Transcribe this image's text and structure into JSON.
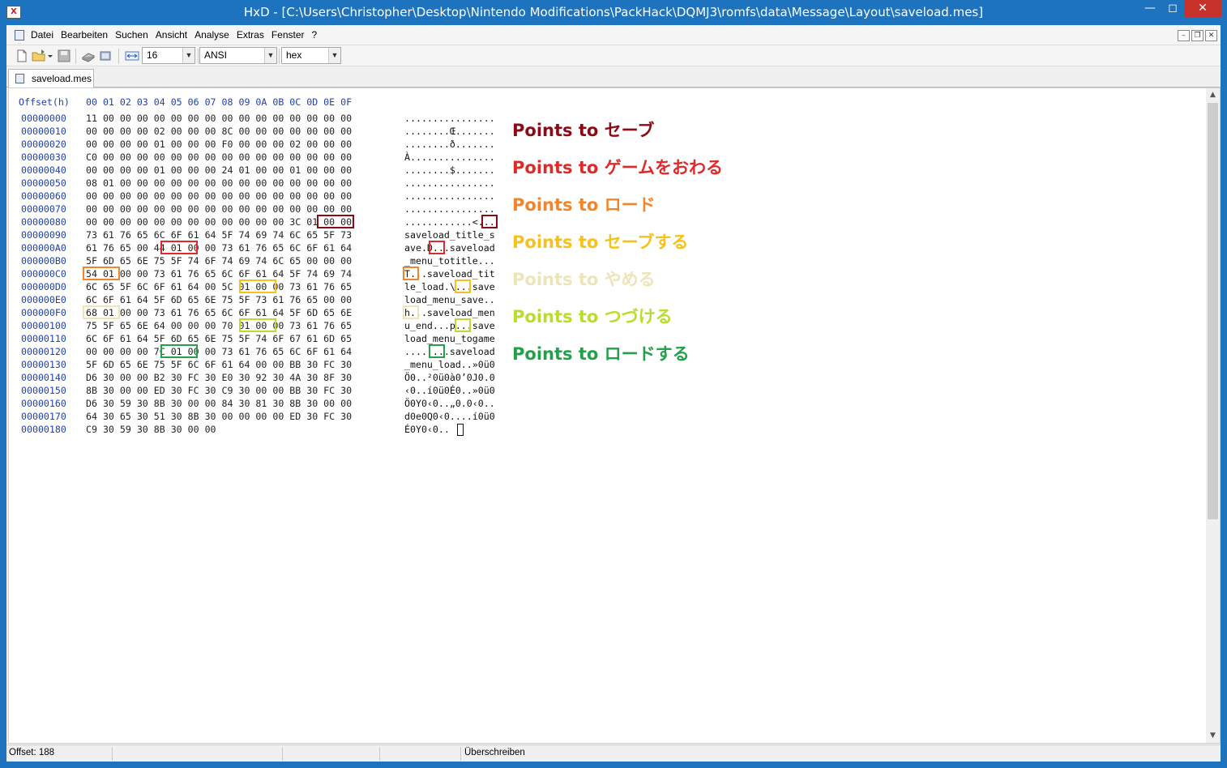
{
  "window": {
    "title": "HxD - [C:\\Users\\Christopher\\Desktop\\Nintendo Modifications\\PackHack\\DQMJ3\\romfs\\data\\Message\\Layout\\saveload.mes]",
    "app_icon_text": "X"
  },
  "menu": [
    "Datei",
    "Bearbeiten",
    "Suchen",
    "Ansicht",
    "Analyse",
    "Extras",
    "Fenster",
    "?"
  ],
  "toolbar": {
    "bytes_per_row": "16",
    "charset": "ANSI",
    "offset_base": "hex"
  },
  "tab": {
    "label": "saveload.mes"
  },
  "hex": {
    "header_offset": "Offset(h)",
    "header_columns": "00 01 02 03 04 05 06 07 08 09 0A 0B 0C 0D 0E 0F",
    "rows": [
      {
        "offset": "00000000",
        "bytes": "11 00 00 00 00 00 00 00 00 00 00 00 00 00 00 00",
        "text": "................"
      },
      {
        "offset": "00000010",
        "bytes": "00 00 00 00 02 00 00 00 8C 00 00 00 00 00 00 00",
        "text": "........Œ......."
      },
      {
        "offset": "00000020",
        "bytes": "00 00 00 00 01 00 00 00 F0 00 00 00 02 00 00 00",
        "text": "........ð......."
      },
      {
        "offset": "00000030",
        "bytes": "C0 00 00 00 00 00 00 00 00 00 00 00 00 00 00 00",
        "text": "À..............."
      },
      {
        "offset": "00000040",
        "bytes": "00 00 00 00 01 00 00 00 24 01 00 00 01 00 00 00",
        "text": "........$......."
      },
      {
        "offset": "00000050",
        "bytes": "08 01 00 00 00 00 00 00 00 00 00 00 00 00 00 00",
        "text": "................"
      },
      {
        "offset": "00000060",
        "bytes": "00 00 00 00 00 00 00 00 00 00 00 00 00 00 00 00",
        "text": "................"
      },
      {
        "offset": "00000070",
        "bytes": "00 00 00 00 00 00 00 00 00 00 00 00 00 00 00 00",
        "text": "................"
      },
      {
        "offset": "00000080",
        "bytes": "00 00 00 00 00 00 00 00 00 00 00 00 3C 01 00 00",
        "text": "............<..."
      },
      {
        "offset": "00000090",
        "bytes": "73 61 76 65 6C 6F 61 64 5F 74 69 74 6C 65 5F 73",
        "text": "saveload_title_s"
      },
      {
        "offset": "000000A0",
        "bytes": "61 76 65 00 44 01 00 00 73 61 76 65 6C 6F 61 64",
        "text": "ave.D...saveload"
      },
      {
        "offset": "000000B0",
        "bytes": "5F 6D 65 6E 75 5F 74 6F 74 69 74 6C 65 00 00 00",
        "text": "_menu_totitle..."
      },
      {
        "offset": "000000C0",
        "bytes": "54 01 00 00 73 61 76 65 6C 6F 61 64 5F 74 69 74",
        "text": "T...saveload_tit"
      },
      {
        "offset": "000000D0",
        "bytes": "6C 65 5F 6C 6F 61 64 00 5C 01 00 00 73 61 76 65",
        "text": "le_load.\\...save"
      },
      {
        "offset": "000000E0",
        "bytes": "6C 6F 61 64 5F 6D 65 6E 75 5F 73 61 76 65 00 00",
        "text": "load_menu_save.."
      },
      {
        "offset": "000000F0",
        "bytes": "68 01 00 00 73 61 76 65 6C 6F 61 64 5F 6D 65 6E",
        "text": "h...saveload_men"
      },
      {
        "offset": "00000100",
        "bytes": "75 5F 65 6E 64 00 00 00 70 01 00 00 73 61 76 65",
        "text": "u_end...p...save"
      },
      {
        "offset": "00000110",
        "bytes": "6C 6F 61 64 5F 6D 65 6E 75 5F 74 6F 67 61 6D 65",
        "text": "load_menu_togame"
      },
      {
        "offset": "00000120",
        "bytes": "00 00 00 00 7C 01 00 00 73 61 76 65 6C 6F 61 64",
        "text": "....|...saveload"
      },
      {
        "offset": "00000130",
        "bytes": "5F 6D 65 6E 75 5F 6C 6F 61 64 00 00 BB 30 FC 30",
        "text": "_menu_load..»0ü0"
      },
      {
        "offset": "00000140",
        "bytes": "D6 30 00 00 B2 30 FC 30 E0 30 92 30 4A 30 8F 30",
        "text": "Ö0..²0ü0à0’0J0.0"
      },
      {
        "offset": "00000150",
        "bytes": "8B 30 00 00 ED 30 FC 30 C9 30 00 00 BB 30 FC 30",
        "text": "‹0..í0ü0É0..»0ü0"
      },
      {
        "offset": "00000160",
        "bytes": "D6 30 59 30 8B 30 00 00 84 30 81 30 8B 30 00 00",
        "text": "Ö0Y0‹0..„0.0‹0.."
      },
      {
        "offset": "00000170",
        "bytes": "64 30 65 30 51 30 8B 30 00 00 00 00 ED 30 FC 30",
        "text": "d0e0Q0‹0....í0ü0"
      },
      {
        "offset": "00000180",
        "bytes": "C9 30 59 30 8B 30 00 00",
        "text": "É0Y0‹0.."
      }
    ]
  },
  "annotations": [
    {
      "text": "Points to セーブ",
      "color": "#8b0a14"
    },
    {
      "text": "Points to ゲームをおわる",
      "color": "#e02a2a"
    },
    {
      "text": "Points to ロード",
      "color": "#f2852a"
    },
    {
      "text": "Points to セーブする",
      "color": "#f5c21d"
    },
    {
      "text": "Points to やめる",
      "color": "#ede4b8"
    },
    {
      "text": "Points to つづける",
      "color": "#b8dd2a"
    },
    {
      "text": "Points to ロードする",
      "color": "#22a04a"
    }
  ],
  "status": {
    "offset": "Offset: 188",
    "mode": "Überschreiben"
  }
}
